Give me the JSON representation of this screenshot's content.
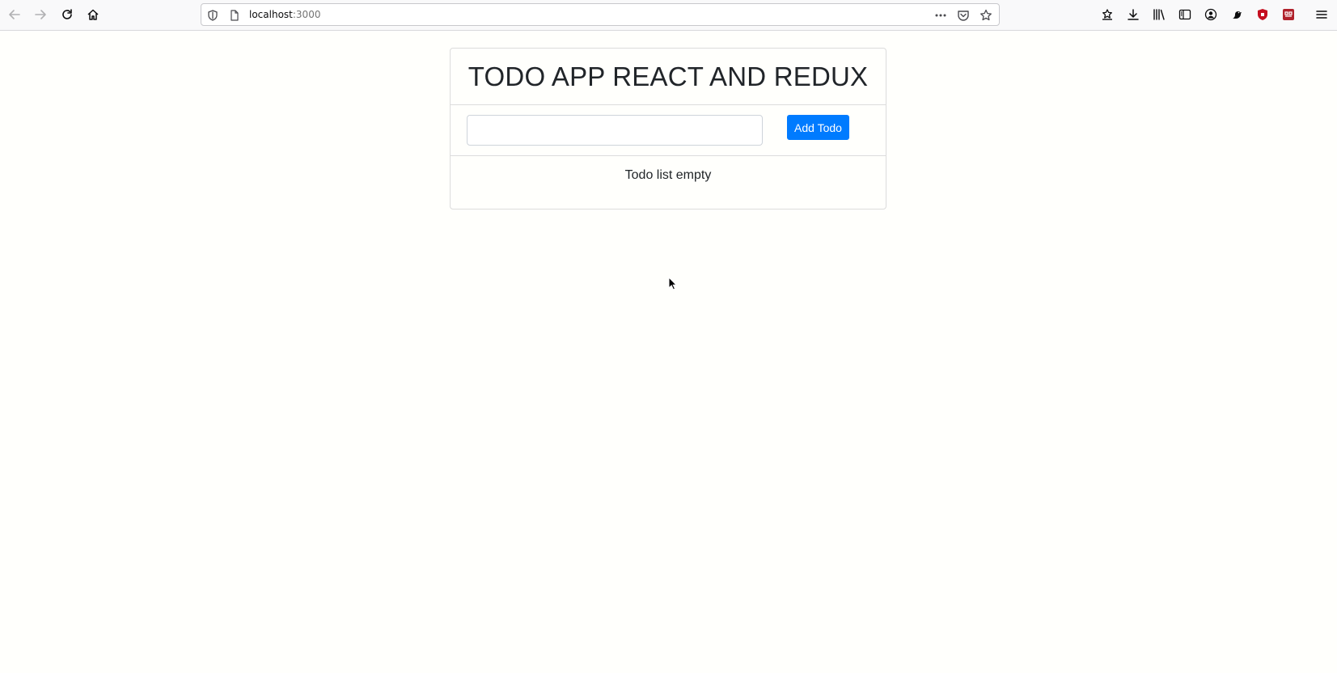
{
  "browser": {
    "url_host": "localhost",
    "url_port": ":3000",
    "icons": {
      "back": "arrow-left-icon",
      "forward": "arrow-right-icon",
      "reload": "reload-icon",
      "home": "home-icon",
      "tracking": "shield-icon",
      "page": "page-icon",
      "page_actions": "more-icon",
      "pocket": "pocket-icon",
      "bookmark": "star-icon",
      "toolbar": [
        "bookmarks-menu-icon",
        "download-icon",
        "library-icon",
        "sidebar-icon",
        "account-icon",
        "extension-icon",
        "ublock-icon",
        "extension-red-icon",
        "hamburger-menu-icon"
      ]
    }
  },
  "app": {
    "title": "TODO APP REACT AND REDUX",
    "input": {
      "value": "",
      "placeholder": ""
    },
    "add_button_label": "Add Todo",
    "empty_message": "Todo list empty",
    "colors": {
      "primary": "#007bff",
      "text": "#212529",
      "border": "#dcdcdc",
      "background": "#fffffc"
    }
  }
}
